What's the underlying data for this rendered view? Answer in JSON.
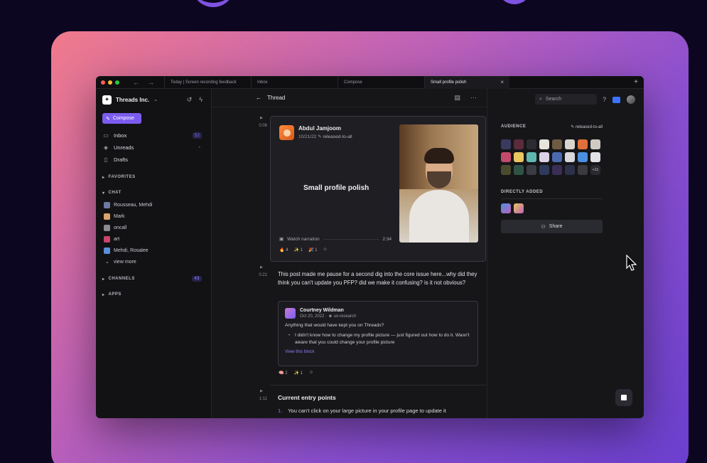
{
  "tabs": [
    {
      "label": "Today | Screen recording feedback"
    },
    {
      "label": "Inbox"
    },
    {
      "label": "Compose"
    },
    {
      "label": "Small profile polish"
    }
  ],
  "sidebar": {
    "org_name": "Threads Inc.",
    "compose_label": "Compose",
    "nav": [
      {
        "label": "Inbox",
        "count": "52",
        "icon": "inbox-icon"
      },
      {
        "label": "Unreads",
        "icon": "layers-icon"
      },
      {
        "label": "Drafts",
        "icon": "document-icon"
      }
    ],
    "favorites_label": "FAVORITES",
    "chat_label": "CHAT",
    "chats": [
      {
        "label": "Rousseau, Mehdi"
      },
      {
        "label": "Mark"
      },
      {
        "label": "oncall"
      },
      {
        "label": "art"
      },
      {
        "label": "Mehdi, Rosalee"
      }
    ],
    "view_more_label": "view more",
    "channels_label": "CHANNELS",
    "channels_count": "43",
    "apps_label": "APPS"
  },
  "thread": {
    "title": "Thread",
    "timestamps": [
      "0:06",
      "0:21",
      "1:11"
    ],
    "video_card": {
      "author": "Abdul Jamjoom",
      "date": "10/21/22",
      "tag": "released-to-all",
      "title": "Small profile polish",
      "narration_label": "Watch narration",
      "duration": "2:34",
      "reactions": [
        {
          "emoji": "🔥",
          "count": "4"
        },
        {
          "emoji": "✨",
          "count": "1"
        },
        {
          "emoji": "🎉",
          "count": "1"
        }
      ]
    },
    "post_text": "This post made me pause for a second dig into the core issue here...why did they think you can't update you PFP? did we make it confusing? is it not obvious?",
    "quote": {
      "author": "Courtney Wildman",
      "date": "Oct 20, 2022",
      "tag": "ux-research",
      "question": "Anything that would have kept you on Threads?",
      "bullet": "I didn't know how to change my profile picture — just figured out how to do it. Wasn't aware that you could change your profile picture",
      "link": "View this block"
    },
    "post_reactions": [
      {
        "emoji": "🧠",
        "count": "2"
      },
      {
        "emoji": "✨",
        "count": "1"
      }
    ],
    "entry_title": "Current entry points",
    "entry_item": "You can't click on your large picture in your profile page to update it",
    "entry_num": "1."
  },
  "right_panel": {
    "search_placeholder": "Search",
    "audience_label": "AUDIENCE",
    "audience_tag": "released-to-all",
    "audience_more": "+11",
    "directly_added_label": "DIRECTLY ADDED",
    "share_label": "Share"
  },
  "colors": {
    "accent": "#7c5cf0",
    "backdrop_from": "#f07a8c",
    "backdrop_to": "#6b3fcf"
  }
}
